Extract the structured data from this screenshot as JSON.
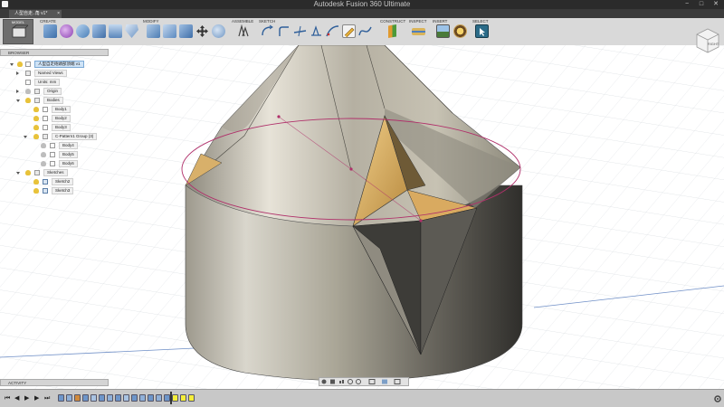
{
  "window": {
    "title": "Autodesk Fusion 360 Ultimate",
    "controls": [
      "−",
      "□",
      "✕"
    ]
  },
  "document_tab": {
    "label": "人型自走..角 v1*",
    "close": "×"
  },
  "workspace": {
    "label": "MODEL",
    "icon": "model-workspace-icon"
  },
  "toolbar": {
    "groups": [
      {
        "label": "CREATE",
        "icons": [
          "box-icon",
          "sphere-icon",
          "revolve-icon",
          "pipe-icon",
          "extrude-icon",
          "shell-icon"
        ]
      },
      {
        "label": "MODIFY",
        "icons": [
          "press-pull-icon",
          "fillet-icon",
          "combine-icon",
          "move-icon",
          "sphere-modify-icon"
        ]
      },
      {
        "label": "ASSEMBLE",
        "icons": [
          "joint-icon"
        ]
      },
      {
        "label": "SKETCH",
        "icons": [
          "arc-icon",
          "fillet-sketch-icon",
          "trim-icon",
          "dimension-icon",
          "spline-icon",
          "edit-sketch-icon",
          "curve-icon"
        ]
      },
      {
        "label": "CONSTRUCT",
        "icons": [
          "plane-icon"
        ]
      },
      {
        "label": "INSPECT",
        "icons": [
          "measure-icon"
        ]
      },
      {
        "label": "INSERT",
        "icons": [
          "image-icon",
          "mesh-icon"
        ]
      },
      {
        "label": "SELECT",
        "icons": [
          "select-icon"
        ]
      }
    ]
  },
  "browser": {
    "header": "BROWSER",
    "items": [
      {
        "label": "人型自走砲頭部頂端 v1",
        "kind": "root",
        "selected": true
      },
      {
        "label": "Named Views",
        "kind": "folder"
      },
      {
        "label": "Units: mm",
        "kind": "units"
      },
      {
        "label": "Origin",
        "kind": "folder"
      },
      {
        "label": "Bodies",
        "kind": "folder"
      },
      {
        "label": "Body1",
        "kind": "body"
      },
      {
        "label": "Body2",
        "kind": "body"
      },
      {
        "label": "Body3",
        "kind": "body"
      },
      {
        "label": "C-Pattern1 Group (3)",
        "kind": "folder"
      },
      {
        "label": "Body4",
        "kind": "body"
      },
      {
        "label": "Body5",
        "kind": "body"
      },
      {
        "label": "Body6",
        "kind": "body"
      },
      {
        "label": "Sketches",
        "kind": "folder"
      },
      {
        "label": "Sketch2",
        "kind": "sketch"
      },
      {
        "label": "Sketch3",
        "kind": "sketch"
      }
    ]
  },
  "activity": {
    "label": "ACTIVITY"
  },
  "viewcube": {
    "face": "RIGHT"
  },
  "timeline": {
    "controls": [
      "⏮",
      "◀",
      "▶",
      "▶",
      "⏭"
    ],
    "settings_icon": "gear-icon",
    "features": 17
  },
  "colors": {
    "titlebar": "#2b2b2b",
    "toolbar": "#d9d9d9",
    "selected": "#cfe3f6",
    "sketch_line": "#b0306a",
    "body_metal": "#b8b4a8",
    "body_gold": "#c9a35a",
    "highlight": "#f5ee3a"
  }
}
